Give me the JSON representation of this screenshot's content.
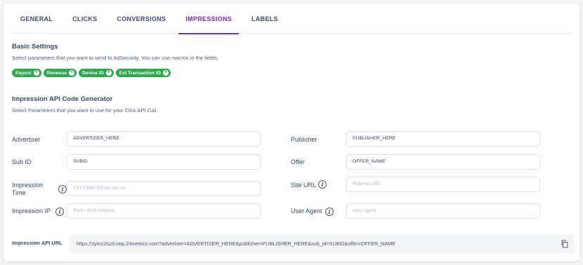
{
  "tabs": [
    "GENERAL",
    "CLICKS",
    "CONVERSIONS",
    "IMPRESSIONS",
    "LABELS"
  ],
  "active_tab": "IMPRESSIONS",
  "accent_color": "#7b2cbf",
  "chip_color": "#2fa84f",
  "basic": {
    "title": "Basic Settings",
    "subtitle": "Select parameters that you want to send to AdSecurity. You can use macros in the fields.",
    "chips": [
      "Payout",
      "Revenue",
      "Device ID",
      "Ext Transaction ID"
    ]
  },
  "generator": {
    "title": "Impression API Code Generator",
    "subtitle": "Select Parameters that you want to use for your Click API Call."
  },
  "fields": {
    "advertiser": {
      "label": "Advertiser",
      "value": "ADVERTISER_HERE"
    },
    "sub_id": {
      "label": "Sub ID",
      "value": "SUBID"
    },
    "impression_time": {
      "label_line1": "Impression",
      "label_line2": "Time",
      "placeholder": "YYYY-MM-DD hh:mm:ss"
    },
    "impression_ip": {
      "label": "Impression IP",
      "placeholder": "IPv4 / IPv6 Address"
    },
    "publisher": {
      "label": "Publisher",
      "value": "PUBLISHER_HERE"
    },
    "offer": {
      "label": "Offer",
      "value": "OFFER_NAME"
    },
    "site_url": {
      "label": "Site URL",
      "placeholder": "Referral URL"
    },
    "user_agent": {
      "label": "User Agent",
      "placeholder": "User Agent"
    }
  },
  "api_url": {
    "label": "Impression API URL",
    "value": "https://zyinz2isz0.imp.24metrics.com?advertiser=ADVERTISER_HERE&publisher=PUBLISHER_HERE&sub_id=SUBID&offer=OFFER_NAME",
    "copy_icon": "copy-icon"
  },
  "info_icon": "info-icon"
}
